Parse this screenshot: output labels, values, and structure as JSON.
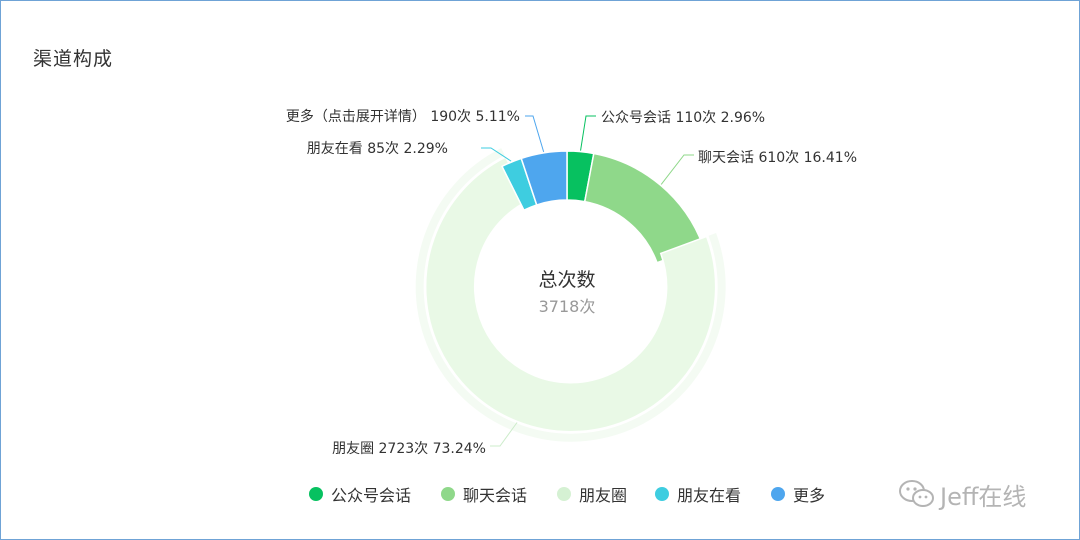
{
  "chart_data": {
    "type": "pie",
    "title": "渠道构成",
    "center_label": "总次数",
    "center_value": "3718次",
    "categories": [
      "公众号会话",
      "聊天会话",
      "朋友圈",
      "朋友在看",
      "更多"
    ],
    "slices": [
      {
        "name": "公众号会话",
        "label": "公众号会话 110次 2.96%",
        "value": 110,
        "percent": 2.96,
        "color": "#07c160"
      },
      {
        "name": "聊天会话",
        "label": "聊天会话 610次 16.41%",
        "value": 610,
        "percent": 16.41,
        "color": "#8fd88a"
      },
      {
        "name": "朋友圈",
        "label": "朋友圈 2723次 73.24%",
        "value": 2723,
        "percent": 73.24,
        "color": "#e9f9e6"
      },
      {
        "name": "朋友在看",
        "label": "朋友在看 85次 2.29%",
        "value": 85,
        "percent": 2.29,
        "color": "#3ecde0"
      },
      {
        "name": "更多",
        "label": "更多（点击展开详情） 190次 5.11%",
        "value": 190,
        "percent": 5.11,
        "color": "#4ea6ee"
      }
    ],
    "legend_position": "bottom",
    "legend": [
      {
        "name": "公众号会话",
        "color": "#07c160"
      },
      {
        "name": "聊天会话",
        "color": "#8fd88a"
      },
      {
        "name": "朋友圈",
        "color": "#d5f1d3"
      },
      {
        "name": "朋友在看",
        "color": "#3ecde0"
      },
      {
        "name": "更多",
        "color": "#4ea6ee"
      }
    ]
  },
  "watermark": {
    "text": "Jeff在线"
  }
}
